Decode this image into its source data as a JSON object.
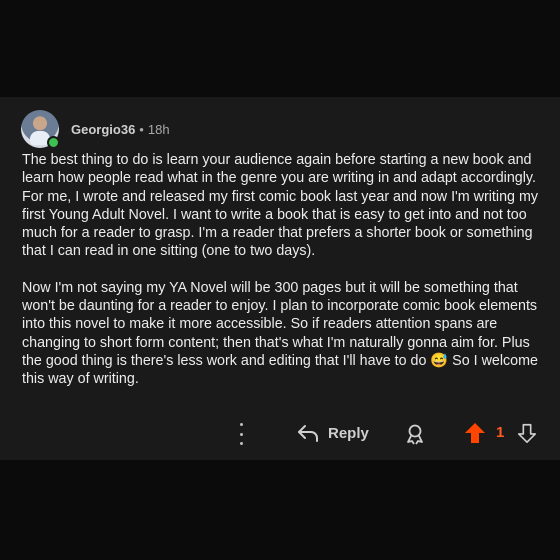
{
  "comment": {
    "username": "Georgio36",
    "separator": "•",
    "timestamp": "18h",
    "online": true,
    "paragraphs": [
      "The best thing to do is learn your audience again before starting a new book and learn how people read what in the genre you are writing in and adapt accordingly. For me, I wrote and released my first comic book last year and now I'm writing my first Young Adult Novel. I want to write a book that is easy to get into and not too much for a reader to grasp. I'm a reader that prefers a shorter book or something that I can read in one sitting (one to two days).",
      "Now I'm not saying my YA Novel will be 300 pages but it will be something that won't be daunting for a reader to enjoy. I plan to incorporate comic book elements into this novel to make it more accessible. So if readers attention spans are changing to short form content; then that's what I'm naturally gonna aim for. Plus the good thing is there's less work and editing that I'll have to do 😅 So I welcome this way of writing."
    ]
  },
  "actions": {
    "reply_label": "Reply",
    "score": "1",
    "icons": {
      "more": "more-options-icon",
      "reply": "reply-arrow-icon",
      "award": "award-icon",
      "upvote": "upvote-arrow-icon",
      "downvote": "downvote-arrow-icon"
    }
  },
  "colors": {
    "background": "#0b0b0b",
    "card": "#1a1a1b",
    "upvote_active": "#ff4500",
    "online": "#3fbf4f"
  }
}
